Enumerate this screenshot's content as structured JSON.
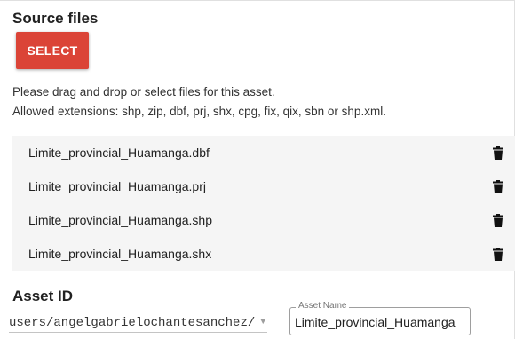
{
  "source": {
    "title": "Source files",
    "select_label": "SELECT",
    "help_line1": "Please drag and drop or select files for this asset.",
    "help_line2": "Allowed extensions: shp, zip, dbf, prj, shx, cpg, fix, qix, sbn or shp.xml.",
    "files": [
      {
        "name": "Limite_provincial_Huamanga.dbf"
      },
      {
        "name": "Limite_provincial_Huamanga.prj"
      },
      {
        "name": "Limite_provincial_Huamanga.shp"
      },
      {
        "name": "Limite_provincial_Huamanga.shx"
      }
    ],
    "delete_icon": "trash-icon"
  },
  "asset": {
    "title": "Asset ID",
    "path_value": "users/angelgabrielochantesanchez/",
    "name_legend": "Asset Name",
    "name_value": "Limite_provincial_Huamanga"
  },
  "colors": {
    "accent": "#db4437",
    "row_bg": "#f5f5f5"
  }
}
